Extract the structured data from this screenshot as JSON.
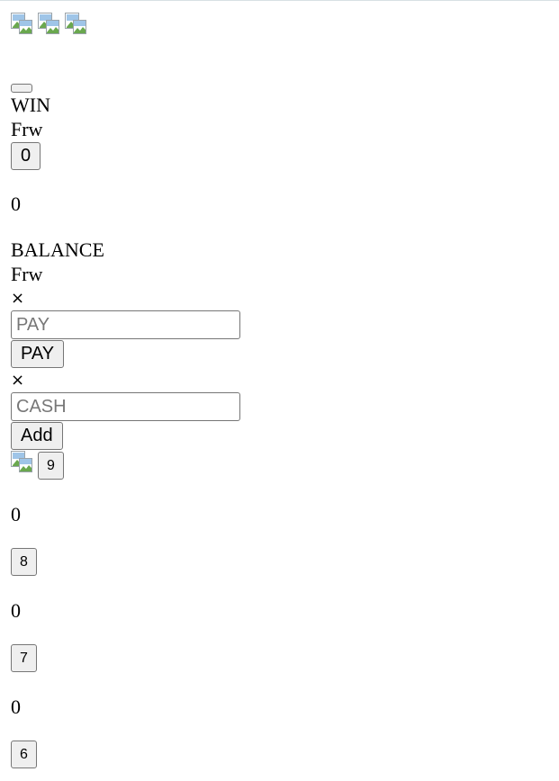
{
  "win": {
    "label": "WIN",
    "currency": "Frw",
    "button_value": "0",
    "amount": "0"
  },
  "balance": {
    "label": "BALANCE",
    "currency": "Frw"
  },
  "pay_form": {
    "close_symbol": "×",
    "placeholder": "PAY",
    "button_label": "PAY"
  },
  "cash_form": {
    "close_symbol": "×",
    "placeholder": "CASH",
    "button_label": "Add"
  },
  "number_buttons": [
    {
      "label": "9",
      "value": "0"
    },
    {
      "label": "8",
      "value": "0"
    },
    {
      "label": "7",
      "value": "0"
    },
    {
      "label": "6",
      "value": ""
    }
  ]
}
